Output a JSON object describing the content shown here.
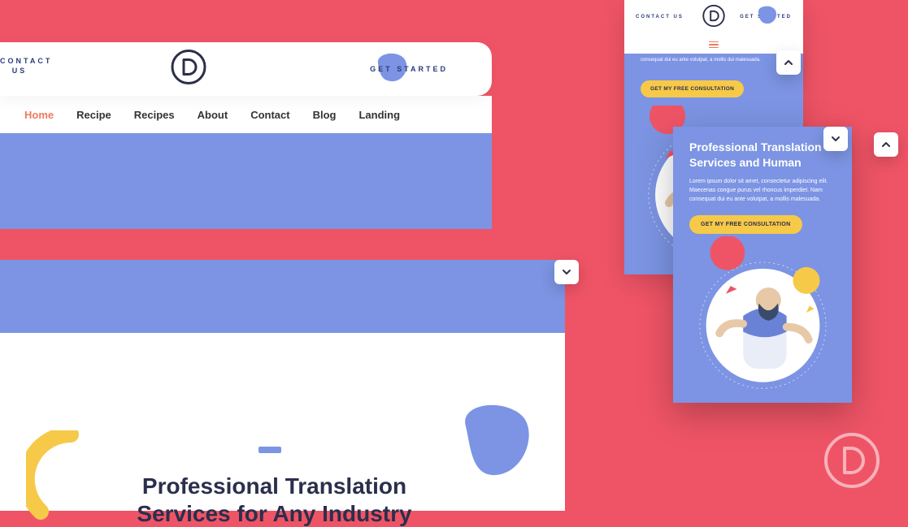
{
  "header": {
    "contact_label": "CONTACT US",
    "get_started_label": "GET STARTED",
    "nav": [
      {
        "label": "Home",
        "active": true
      },
      {
        "label": "Recipe",
        "active": false
      },
      {
        "label": "Recipes",
        "active": false
      },
      {
        "label": "About",
        "active": false
      },
      {
        "label": "Contact",
        "active": false
      },
      {
        "label": "Blog",
        "active": false
      },
      {
        "label": "Landing",
        "active": false
      }
    ]
  },
  "hero": {
    "title_line1": "Professional Translation",
    "title_line2": "Services for Any Industry"
  },
  "mobile1": {
    "contact_label": "CONTACT US",
    "get_started_label": "GET STARTED",
    "body_text": "consequat dui eu ante volutpat, a mollis dui malesuada.",
    "cta_label": "GET MY FREE CONSULTATION"
  },
  "mobile2": {
    "title_line1": "Professional Translation",
    "title_line2": "Services and Human",
    "body_text": "Lorem ipsum dolor sit amet, consectetur adipiscing elit. Maecenas congue purus vel rhoncus imperdiet. Nam consequat dui eu ante volutpat, a mollis malesuada.",
    "cta_label": "GET MY FREE CONSULTATION"
  },
  "icons": {
    "logo": "divi-logo",
    "chevron_up": "chevron-up-icon",
    "chevron_down": "chevron-down-icon",
    "menu": "hamburger-icon"
  },
  "colors": {
    "background": "#ef5466",
    "periwinkle": "#7c94e3",
    "navy": "#2a3b7a",
    "yellow": "#f7c948",
    "accent_orange": "#ef7a5d"
  }
}
